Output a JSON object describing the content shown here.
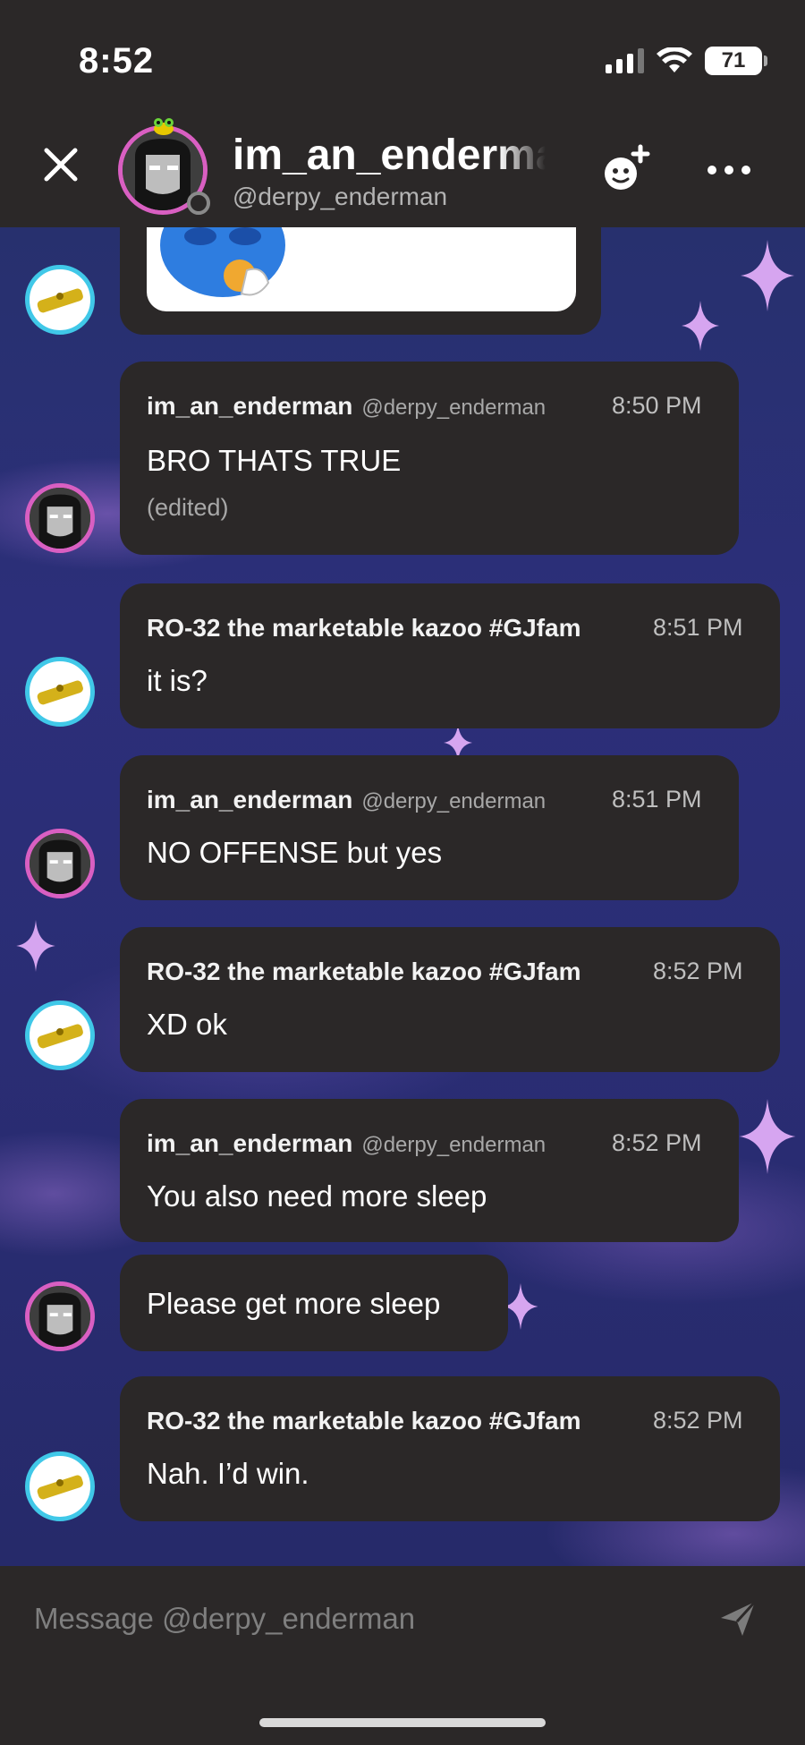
{
  "status_bar": {
    "time": "8:52",
    "battery": "71"
  },
  "header": {
    "title": "im_an_enderman",
    "subtitle": "@derpy_enderman",
    "close_icon": "close-icon",
    "add_friend_icon": "add-friend-icon",
    "more_icon": "more-icon"
  },
  "messages": [
    {
      "author": "im_an_enderman",
      "handle": "@derpy_enderman",
      "time": "8:50 PM",
      "text": "BRO THATS TRUE",
      "edited": "(edited)"
    },
    {
      "author": "RO-32 the marketable kazoo #GJfam",
      "time": "8:51 PM",
      "text": "it is?"
    },
    {
      "author": "im_an_enderman",
      "handle": "@derpy_enderman",
      "time": "8:51 PM",
      "text": "NO OFFENSE but yes"
    },
    {
      "author": "RO-32 the marketable kazoo #GJfam",
      "time": "8:52 PM",
      "text": "XD ok"
    },
    {
      "author": "im_an_enderman",
      "handle": "@derpy_enderman",
      "time": "8:52 PM",
      "text": "You also need more sleep"
    },
    {
      "text": "Please get more sleep"
    },
    {
      "author": "RO-32 the marketable kazoo #GJfam",
      "time": "8:52 PM",
      "text": "Nah. I’d win."
    }
  ],
  "composer": {
    "placeholder": "Message @derpy_enderman",
    "send_icon": "send-icon"
  },
  "colors": {
    "background": "#2b2828",
    "bubble": "#2b2828",
    "chat_bg": "#2a2d74",
    "ender_ring": "#d95fc2",
    "kazoo_ring": "#40c8e8"
  }
}
